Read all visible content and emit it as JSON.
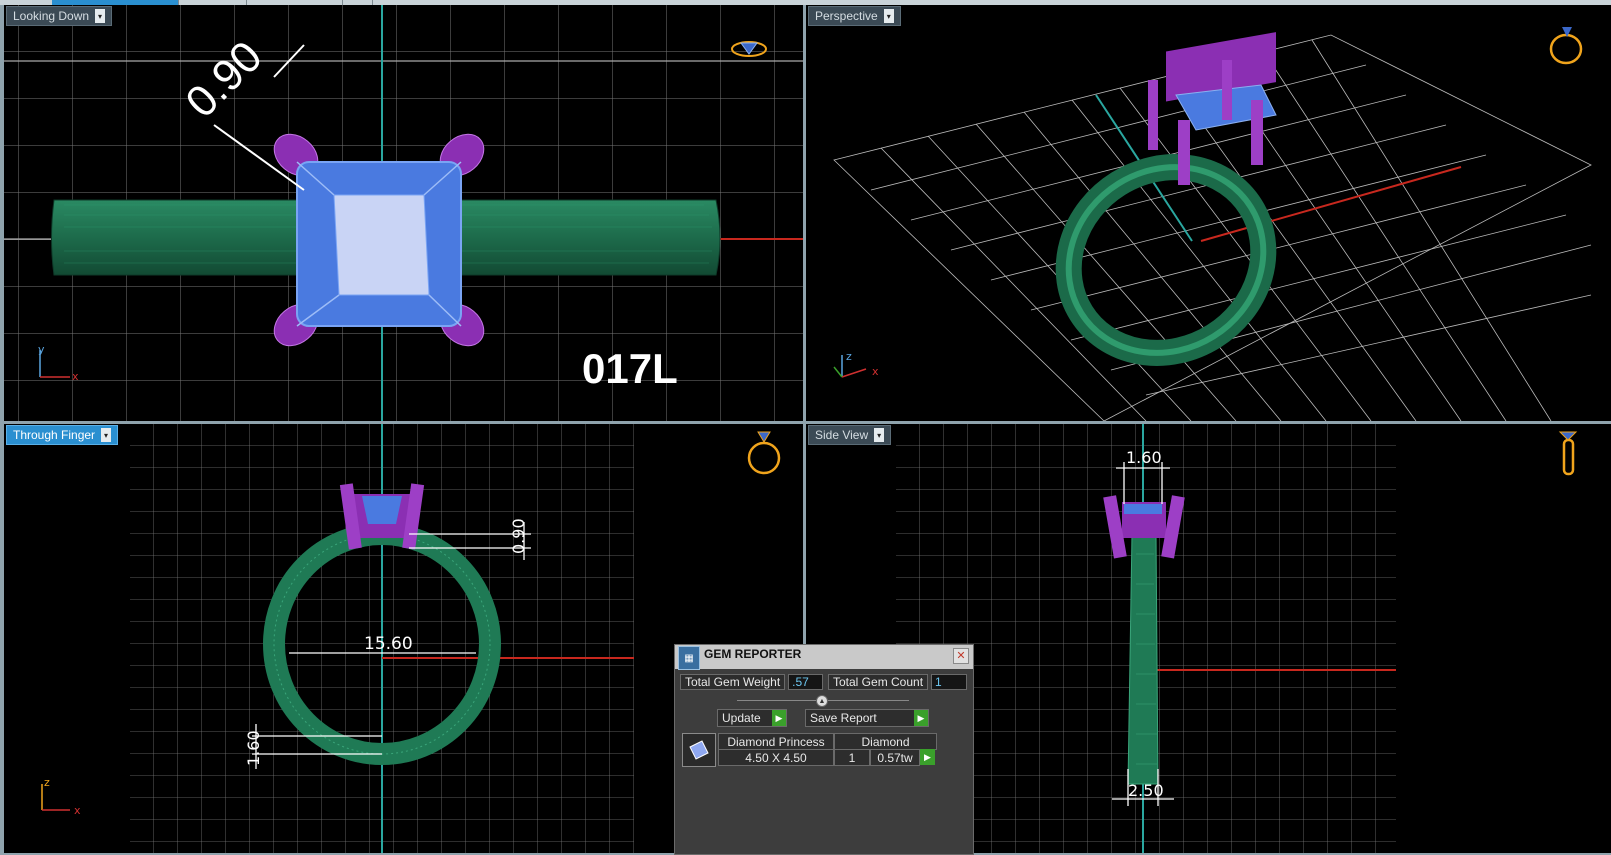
{
  "viewports": {
    "top_left": {
      "label": "Looking Down",
      "active": false,
      "dimension": "0.90",
      "part_code": "017L"
    },
    "top_right": {
      "label": "Perspective",
      "active": false
    },
    "bottom_left": {
      "label": "Through Finger",
      "active": true,
      "dim_inner": "15.60",
      "dim_right": "0.90",
      "dim_bottom": "1.60"
    },
    "bottom_right": {
      "label": "Side View",
      "active": false,
      "dim_top": "1.60",
      "dim_bottom": "2.50"
    }
  },
  "axes": {
    "x": "x",
    "y": "y",
    "z": "z"
  },
  "icons": {
    "dropdown": "▾"
  },
  "colors": {
    "band": "#1f6e4e",
    "prongs": "#8b2fb3",
    "stone": "#4a7ae0",
    "accent": "#2a8fd0",
    "grid": "#7c7c7c"
  },
  "gem_reporter": {
    "title": "GEM REPORTER",
    "close": "✕",
    "total_weight_label": "Total Gem Weight",
    "total_weight_value": ".57",
    "total_count_label": "Total Gem Count",
    "total_count_value": "1",
    "update_label": "Update",
    "save_label": "Save Report",
    "go_glyph": "▶",
    "row": {
      "name": "Diamond Princess",
      "size": "4.50 X 4.50",
      "material": "Diamond",
      "count": "1",
      "weight": "0.57tw"
    }
  }
}
